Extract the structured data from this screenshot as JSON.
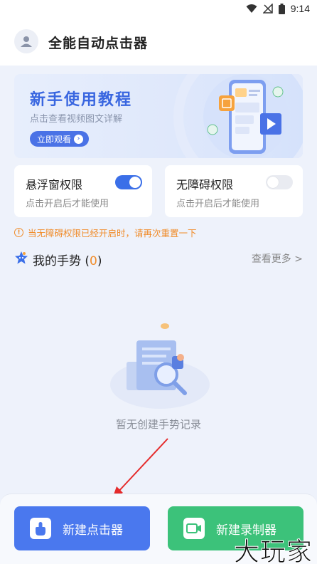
{
  "status_bar": {
    "time": "9:14"
  },
  "header": {
    "title": "全能自动点击器"
  },
  "banner": {
    "title": "新手使用教程",
    "subtitle": "点击查看视频图文详解",
    "button_label": "立即观看"
  },
  "permissions": [
    {
      "title": "悬浮窗权限",
      "description": "点击开启后才能使用",
      "enabled": true
    },
    {
      "title": "无障碍权限",
      "description": "点击开启后才能使用",
      "enabled": false
    }
  ],
  "warning": {
    "text": "当无障碍权限已经开启时，请再次重置一下"
  },
  "gestures": {
    "title": "我的手势",
    "count_open": "(",
    "count": "0",
    "count_close": ")",
    "view_more": "查看更多 >"
  },
  "empty_state": {
    "text": "暂无创建手势记录"
  },
  "actions": {
    "new_clicker": "新建点击器",
    "new_recorder": "新建录制器"
  },
  "watermark": {
    "text": "大玩家"
  },
  "colors": {
    "accent": "#3b6fe8",
    "warning": "#f08c2a",
    "green": "#3cc27a",
    "background": "#eef2fb"
  }
}
